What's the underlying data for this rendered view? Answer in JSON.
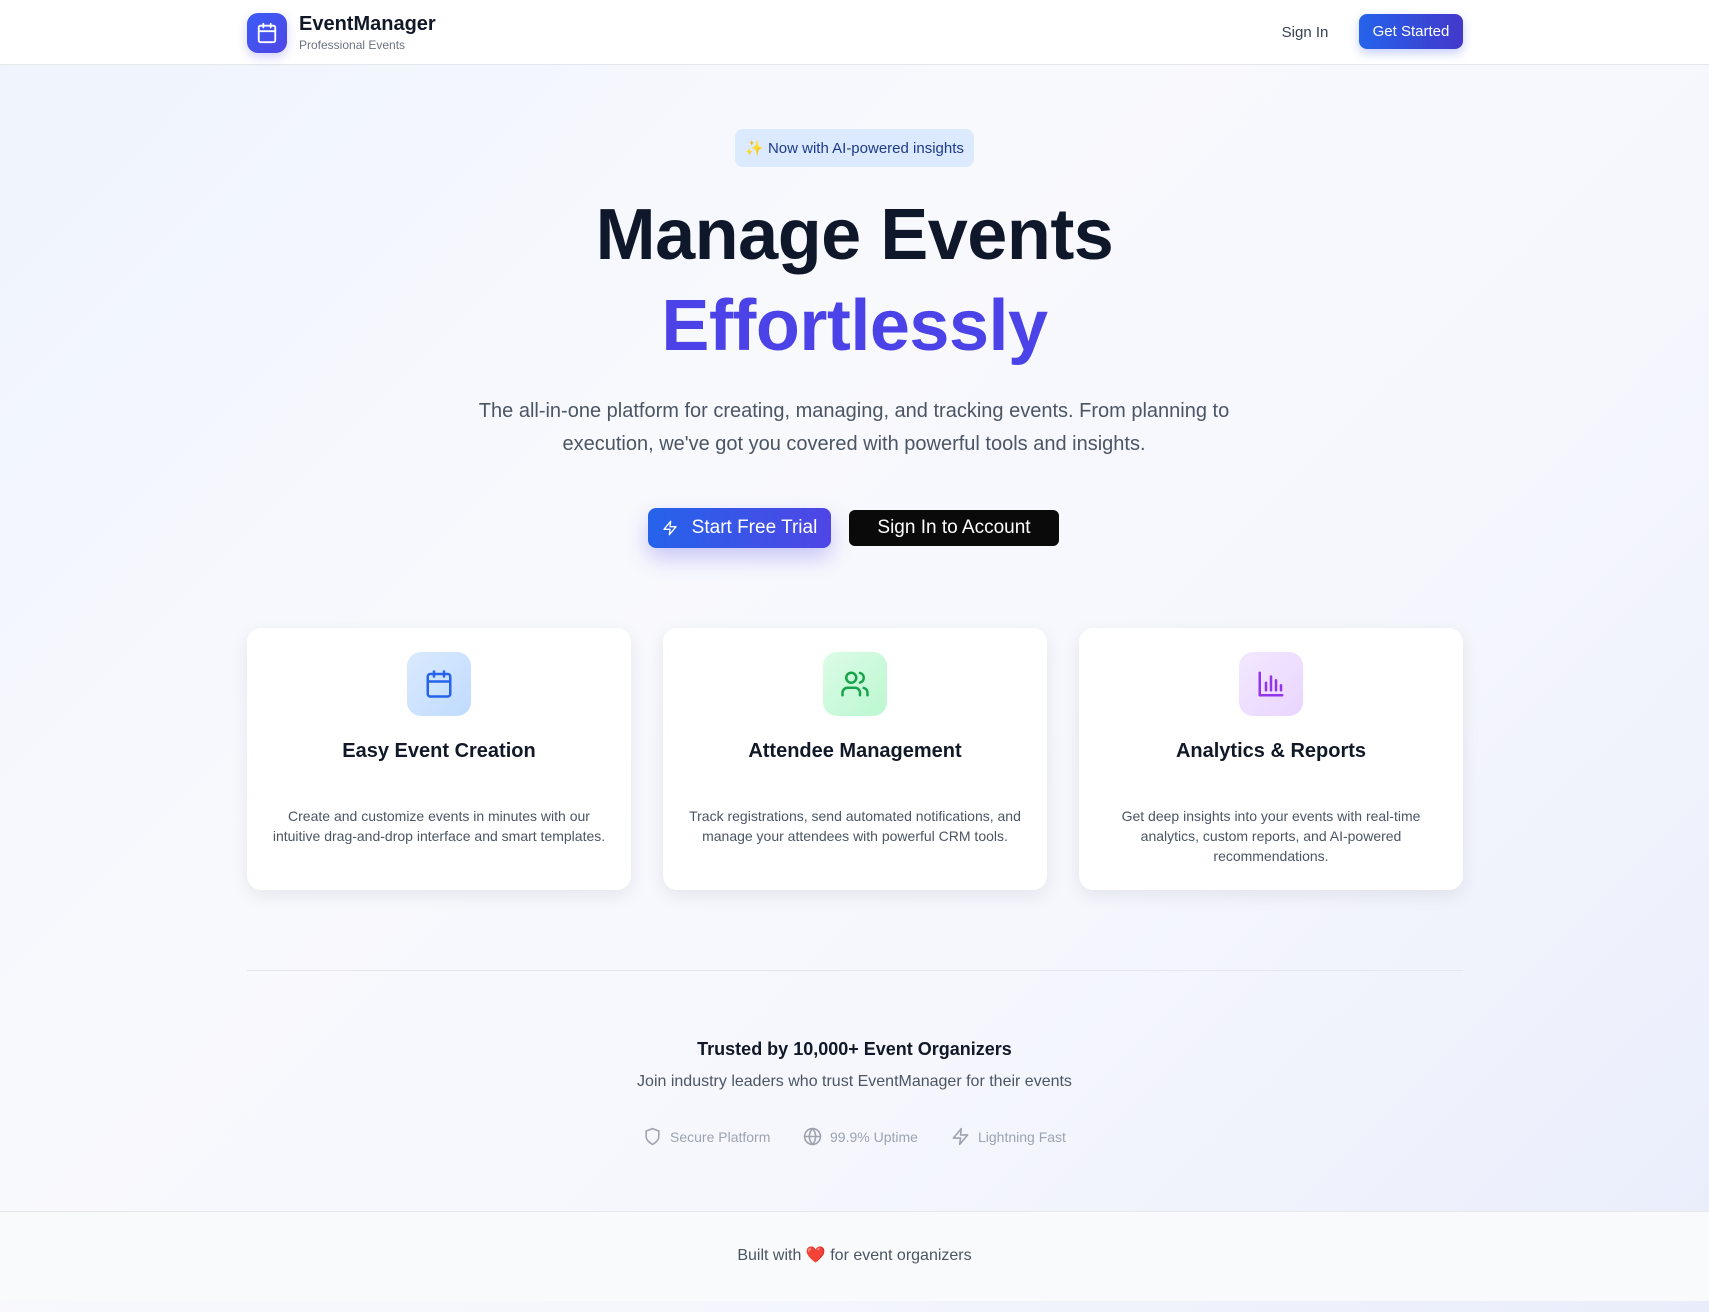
{
  "header": {
    "brand_name": "EventManager",
    "brand_tagline": "Professional Events",
    "logo_icon": "calendar-icon",
    "sign_in_label": "Sign In",
    "get_started_label": "Get Started"
  },
  "hero": {
    "badge_text": "✨ Now with AI-powered insights",
    "title_line1": "Manage Events",
    "title_line2": "Effortlessly",
    "subtitle": "The all-in-one platform for creating, managing, and tracking events. From planning to execution, we've got you covered with powerful tools and insights.",
    "primary_cta": "Start Free Trial",
    "primary_cta_icon": "zap-icon",
    "secondary_cta": "Sign In to Account"
  },
  "features": [
    {
      "icon": "calendar-icon",
      "title": "Easy Event Creation",
      "description": "Create and customize events in minutes with our intuitive drag-and-drop interface and smart templates.",
      "icon_color": "#2563eb",
      "icon_bg": "#dbeafe"
    },
    {
      "icon": "users-icon",
      "title": "Attendee Management",
      "description": "Track registrations, send automated notifications, and manage your attendees with powerful CRM tools.",
      "icon_color": "#16a34a",
      "icon_bg": "#dcfce7"
    },
    {
      "icon": "bar-chart-icon",
      "title": "Analytics & Reports",
      "description": "Get deep insights into your events with real-time analytics, custom reports, and AI-powered recommendations.",
      "icon_color": "#9333ea",
      "icon_bg": "#f3e8ff"
    }
  ],
  "trust": {
    "title": "Trusted by 10,000+ Event Organizers",
    "subtitle": "Join industry leaders who trust EventManager for their events",
    "items": [
      {
        "icon": "shield-icon",
        "label": "Secure Platform"
      },
      {
        "icon": "globe-icon",
        "label": "99.9% Uptime"
      },
      {
        "icon": "zap-icon",
        "label": "Lightning Fast"
      }
    ]
  },
  "footer": {
    "text_before": "Built with",
    "heart": "❤️",
    "text_after": "for event organizers"
  },
  "colors": {
    "brand_primary": "#4f46e5",
    "brand_blue": "#2563eb",
    "title_dark": "#0f172a",
    "title_accent": "#4b43e8"
  }
}
